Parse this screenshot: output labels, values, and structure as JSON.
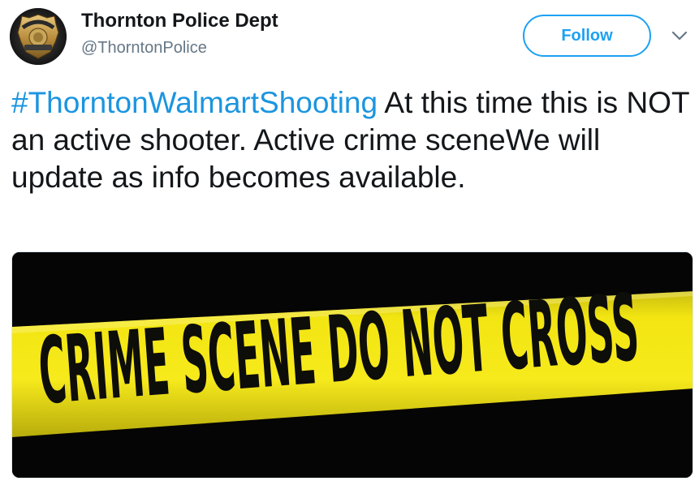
{
  "user": {
    "display_name": "Thornton Police Dept",
    "handle": "@ThorntonPolice",
    "avatar_icon": "police-badge-icon",
    "avatar_text_top": "POLICE OFFICER",
    "avatar_text_bottom": "THORNTON POLICE"
  },
  "actions": {
    "follow_label": "Follow",
    "menu_icon": "chevron-down-icon"
  },
  "tweet": {
    "hashtag": "#ThorntonWalmartShooting",
    "body": " At this time this is NOT an active shooter. Active crime sceneWe will update as info becomes available."
  },
  "media": {
    "tape_text": "CRIME SCENE DO NOT CROSS",
    "colors": {
      "background": "#050505",
      "tape": "#f2e512",
      "text": "#0d0d0a"
    }
  },
  "colors": {
    "accent": "#1da1f2",
    "link": "#1b95e0",
    "text": "#14171a",
    "secondary": "#657786"
  }
}
